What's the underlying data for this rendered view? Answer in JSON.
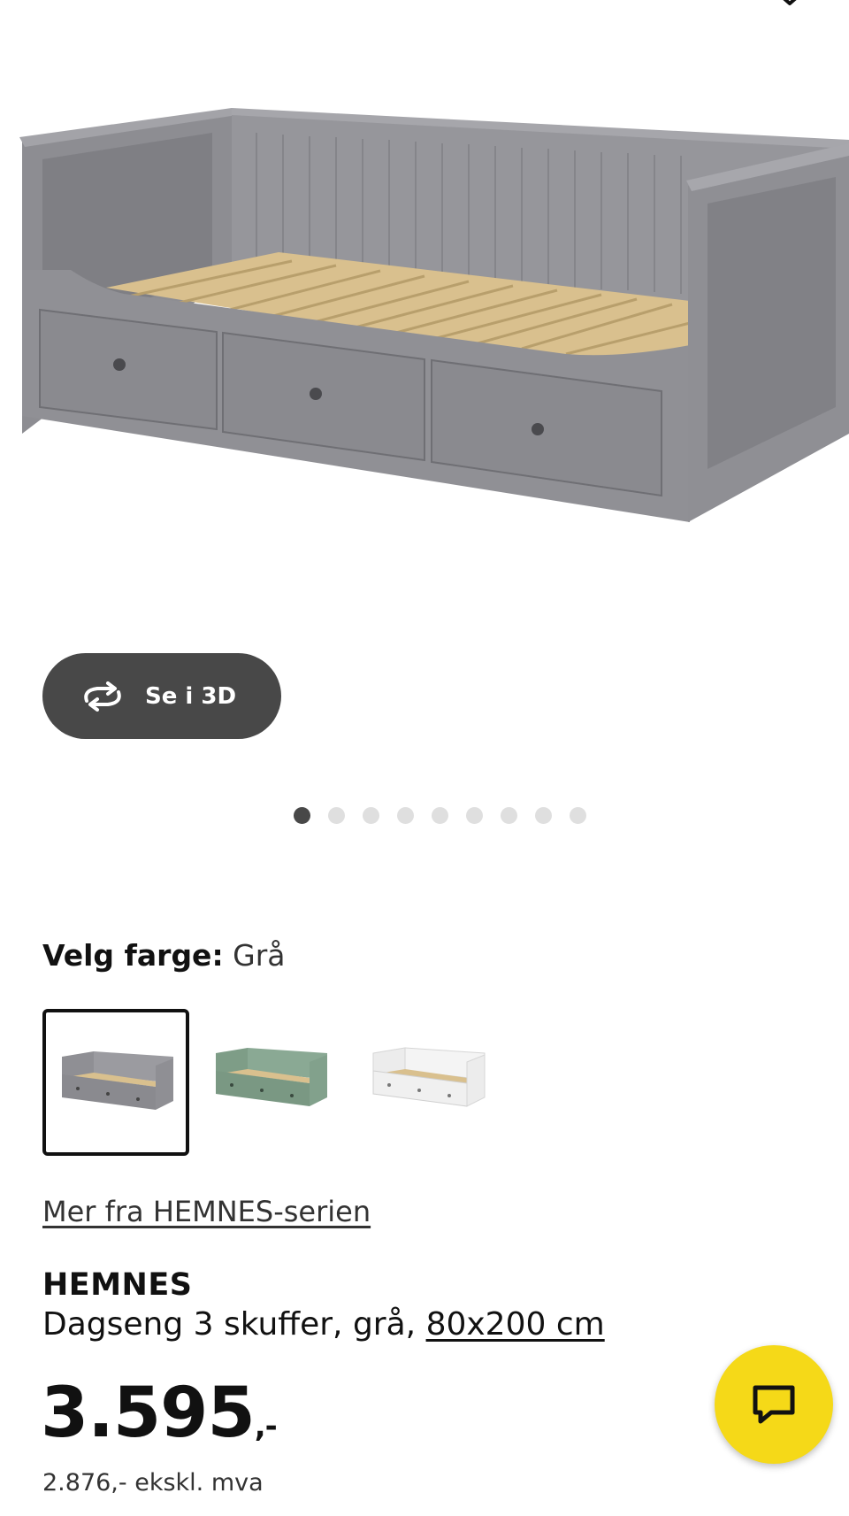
{
  "gallery": {
    "see_3d_label": "Se i 3D",
    "image_count": 9,
    "current_index": 1
  },
  "color_picker": {
    "label": "Velg farge:",
    "selected_value": "Grå",
    "options": [
      {
        "name": "Grå",
        "color": "#8f8f94",
        "selected": true
      },
      {
        "name": "Grønn",
        "color": "#86a58f",
        "selected": false
      },
      {
        "name": "Hvit",
        "color": "#f2f2f2",
        "selected": false
      }
    ]
  },
  "series_link": "Mer fra HEMNES-serien",
  "product": {
    "name": "HEMNES",
    "description": "Dagseng 3 skuffer, grå,",
    "size": "80x200 cm"
  },
  "price": {
    "amount": "3.595",
    "suffix": ",-",
    "excl_vat": "2.876,- ekskl. mva"
  },
  "colors": {
    "accent_yellow": "#f5d918",
    "button_dark": "#484848"
  },
  "icons": {
    "wishlist": "heart-icon",
    "rotate": "rotate-3d-icon",
    "chat": "chat-icon"
  }
}
